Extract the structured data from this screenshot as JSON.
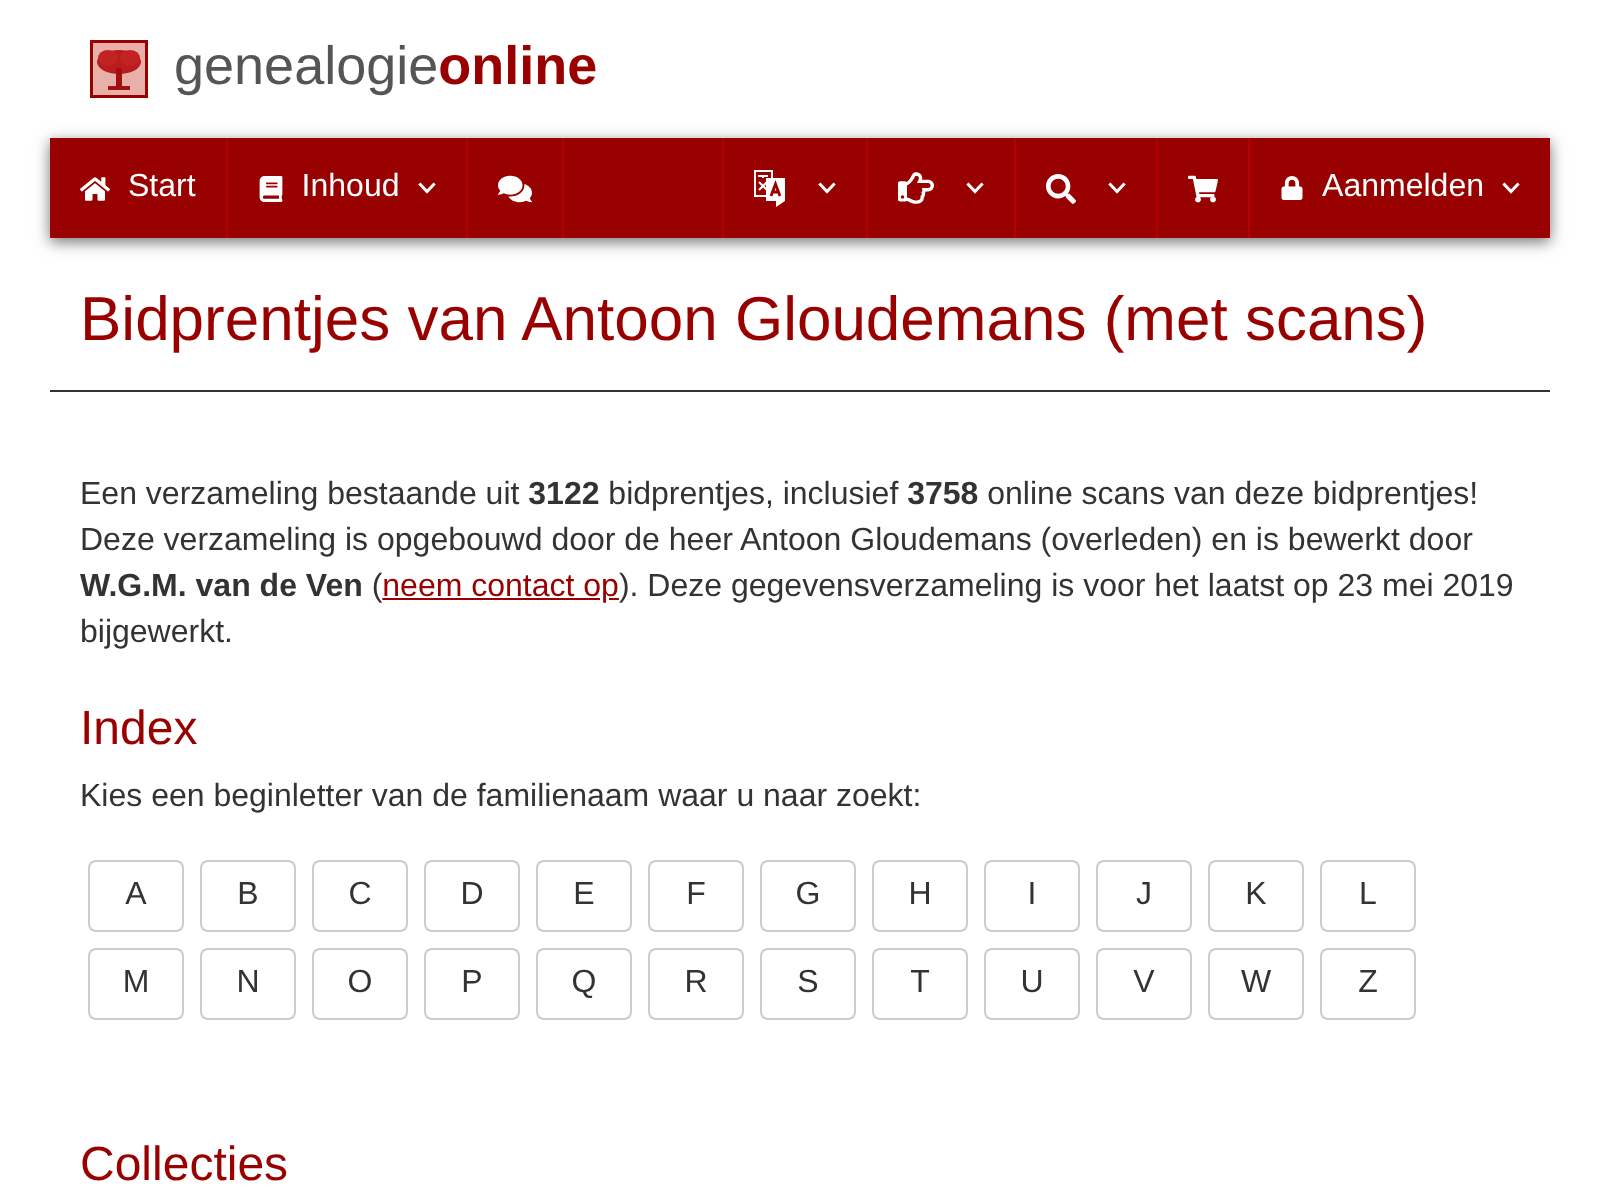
{
  "logo": {
    "text": "genealogie",
    "accent": "online"
  },
  "nav": {
    "left": [
      {
        "kind": "home",
        "label": "Start",
        "dropdown": false
      },
      {
        "kind": "contents",
        "label": "Inhoud",
        "dropdown": true
      },
      {
        "kind": "chat",
        "dropdown": false
      }
    ],
    "right": [
      {
        "kind": "language",
        "dropdown": true
      },
      {
        "kind": "tips",
        "dropdown": true
      },
      {
        "kind": "search",
        "dropdown": true
      },
      {
        "kind": "cart",
        "dropdown": false
      },
      {
        "kind": "account",
        "label": "Aanmelden",
        "dropdown": true
      }
    ]
  },
  "page": {
    "title": "Bidprentjes van Antoon Gloudemans (met scans)"
  },
  "intro": {
    "before": "Een verzameling bestaande uit **3122** bidprentjes, inclusief **3758** online scans van deze bidprentjes! Deze verzameling is opgebouwd door de heer Antoon Gloudemans (overleden) en is bewerkt door **W.G.M. van de Ven** (",
    "link": "neem contact op",
    "after": "). Deze gegevensverzameling is voor het laatst op 23 mei 2019 bijgewerkt."
  },
  "index": {
    "heading": "Index",
    "instruction": "Kies een beginletter van de familienaam waar u naar zoekt:",
    "letters": [
      "A",
      "B",
      "C",
      "D",
      "E",
      "F",
      "G",
      "H",
      "I",
      "J",
      "K",
      "L",
      "M",
      "N",
      "O",
      "P",
      "Q",
      "R",
      "S",
      "T",
      "U",
      "V",
      "W",
      "Z"
    ]
  },
  "collections": {
    "heading": "Collecties"
  }
}
